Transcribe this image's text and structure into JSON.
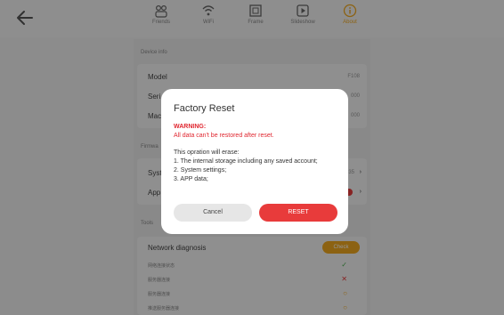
{
  "nav": {
    "tabs": [
      {
        "label": "Friends",
        "icon": "friends-icon"
      },
      {
        "label": "WiFi",
        "icon": "wifi-icon"
      },
      {
        "label": "Frame",
        "icon": "frame-icon"
      },
      {
        "label": "Slideshow",
        "icon": "slideshow-icon"
      },
      {
        "label": "About",
        "icon": "info-icon",
        "active": true
      }
    ]
  },
  "about": {
    "device_info_header": "Device info",
    "model_label": "Model",
    "model_value": "F108",
    "serial_label": "Seri",
    "serial_value": "000",
    "mac_label": "Mac",
    "mac_value": "000",
    "firmware_header": "Firmwa",
    "system_label": "Syst",
    "system_value": "035",
    "app_label": "App",
    "tools_header": "Tools",
    "network_diagnosis_label": "Network diagnosis",
    "check_label": "Check",
    "diag_items": [
      {
        "label": "网络连接状态",
        "status": "✓"
      },
      {
        "label": "服务器连接",
        "status": "✕"
      },
      {
        "label": "服务器连接",
        "status": "○"
      },
      {
        "label": "推送服务器连接",
        "status": "○"
      }
    ]
  },
  "dialog": {
    "title": "Factory Reset",
    "warning_label": "WARNING:",
    "warning_text": "All data can't be restored after reset.",
    "body_intro": "This opration will erase:",
    "body_items": [
      "1. The internal storage including any saved account;",
      "2. System settings;",
      "3. APP data;"
    ],
    "cancel_label": "Cancel",
    "reset_label": "RESET"
  },
  "colors": {
    "accent": "#f2a91f",
    "danger": "#e83b3b",
    "ok": "#4caf50"
  }
}
